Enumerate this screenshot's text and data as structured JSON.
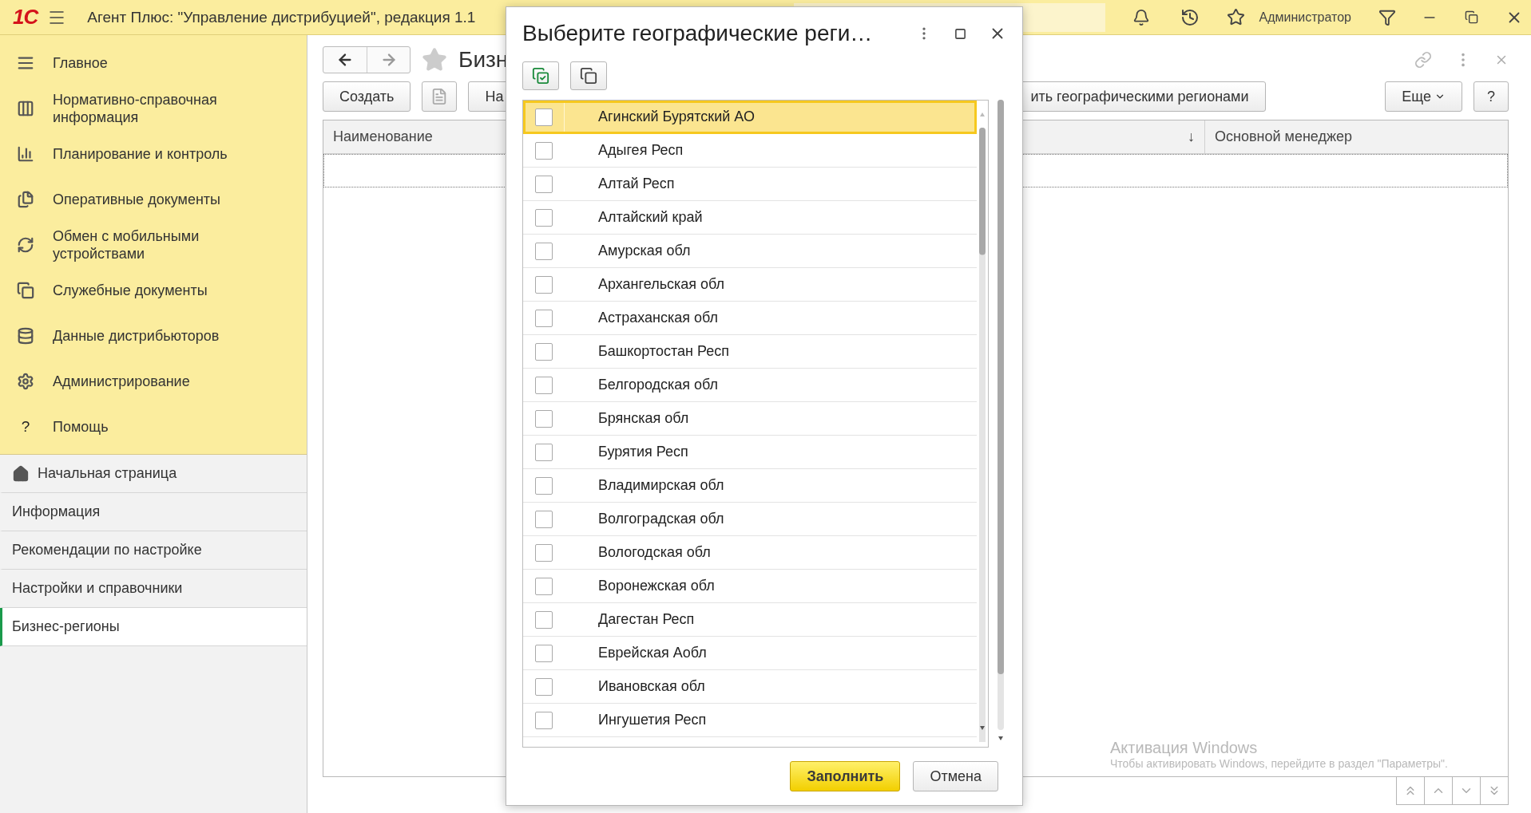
{
  "app_bar": {
    "logo": "1С",
    "title": "Агент Плюс: \"Управление дистрибуцией\", редакция 1.1",
    "user": "Администратор"
  },
  "sidebar": {
    "sections": [
      {
        "label": "Главное"
      },
      {
        "label": "Нормативно-справочная информация"
      },
      {
        "label": "Планирование и контроль"
      },
      {
        "label": "Оперативные документы"
      },
      {
        "label": "Обмен с мобильными устройствами"
      },
      {
        "label": "Служебные документы"
      },
      {
        "label": "Данные дистрибьюторов"
      },
      {
        "label": "Администрирование"
      },
      {
        "label": "Помощь",
        "glyph": "?"
      }
    ],
    "pages": [
      {
        "label": "Начальная страница",
        "selected": false,
        "kind": "home"
      },
      {
        "label": "Информация",
        "selected": false,
        "kind": "plain"
      },
      {
        "label": "Рекомендации по настройке",
        "selected": false,
        "kind": "plain"
      },
      {
        "label": "Настройки и справочники",
        "selected": false,
        "kind": "plain"
      },
      {
        "label": "Бизнес-регионы",
        "selected": true,
        "kind": "plain"
      }
    ]
  },
  "form": {
    "title": "Бизн",
    "buttons": [
      "Создать",
      "На"
    ],
    "fill_button": "ить географическими регионами",
    "more": "Еще",
    "help": "?",
    "columns": [
      "Наименование",
      "↓",
      "Основной менеджер"
    ]
  },
  "dialog": {
    "title": "Выберите географические реги…",
    "regions": [
      {
        "name": "Агинский Бурятский АО",
        "selected": true,
        "checked": false
      },
      {
        "name": "Адыгея Респ",
        "selected": false,
        "checked": false
      },
      {
        "name": "Алтай Респ",
        "selected": false,
        "checked": false
      },
      {
        "name": "Алтайский край",
        "selected": false,
        "checked": false
      },
      {
        "name": "Амурская обл",
        "selected": false,
        "checked": false
      },
      {
        "name": "Архангельская обл",
        "selected": false,
        "checked": false
      },
      {
        "name": "Астраханская обл",
        "selected": false,
        "checked": false
      },
      {
        "name": "Башкортостан Респ",
        "selected": false,
        "checked": false
      },
      {
        "name": "Белгородская обл",
        "selected": false,
        "checked": false
      },
      {
        "name": "Брянская обл",
        "selected": false,
        "checked": false
      },
      {
        "name": "Бурятия Респ",
        "selected": false,
        "checked": false
      },
      {
        "name": "Владимирская обл",
        "selected": false,
        "checked": false
      },
      {
        "name": "Волгоградская обл",
        "selected": false,
        "checked": false
      },
      {
        "name": "Вологодская обл",
        "selected": false,
        "checked": false
      },
      {
        "name": "Воронежская обл",
        "selected": false,
        "checked": false
      },
      {
        "name": "Дагестан Респ",
        "selected": false,
        "checked": false
      },
      {
        "name": "Еврейская Аобл",
        "selected": false,
        "checked": false
      },
      {
        "name": "Ивановская обл",
        "selected": false,
        "checked": false
      },
      {
        "name": "Ингушетия Респ",
        "selected": false,
        "checked": false
      }
    ],
    "buttons": [
      "Заполнить",
      "Отмена"
    ]
  },
  "os_notice": {
    "title": "Активация Windows",
    "text": "Чтобы активировать Windows, перейдите в раздел \"Параметры\"."
  }
}
